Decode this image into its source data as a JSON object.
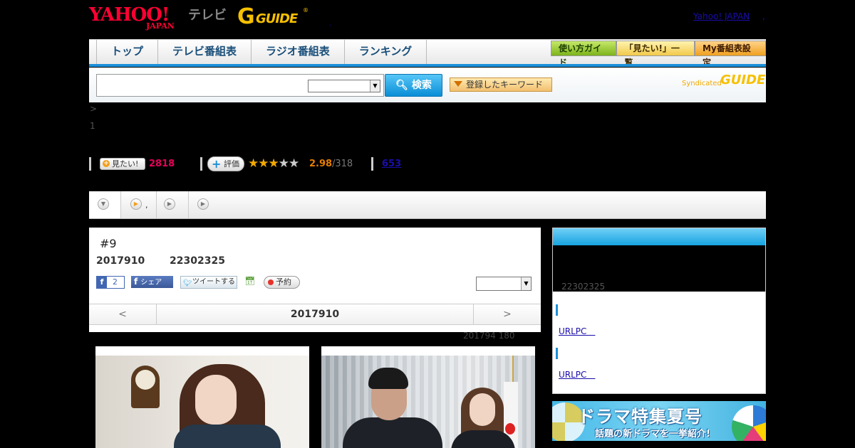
{
  "header": {
    "yahoo_logo": "YAHOO!",
    "yahoo_japan": "JAPAN",
    "tv_label": "テレビ",
    "gguide_g": "G",
    "gguide_text": "GUIDE",
    "gguide_mark": "®",
    "yahoo_japan_link": "Yahoo! JAPAN",
    "link_sep": ",",
    "dot": "."
  },
  "nav": {
    "tabs": [
      "トップ",
      "テレビ番組表",
      "ラジオ番組表",
      "ランキング"
    ],
    "buttons": [
      "使い方ガイド",
      "「見たい!」一覧",
      "My番組表設定"
    ]
  },
  "search": {
    "input_value": "",
    "select_value": "",
    "search_button": "検索",
    "keyword_button": "登録したキーワード",
    "syndicated": "Syndicated",
    "syndicated_g": "GUIDE"
  },
  "breadcrumb": ">",
  "page_number": "1",
  "stats": {
    "mitai_label": "見たい!",
    "mitai_count": "2818",
    "hyoka_label": "評価",
    "rating_value": 2.98,
    "rating_display": "2.98",
    "rating_total": "/318",
    "review_count": "653"
  },
  "subtabs": [
    "",
    ",",
    "",
    ""
  ],
  "episode": {
    "title": "#9",
    "date": "2017910",
    "time": "22302325",
    "fb_like_count": "2",
    "fb_share_label": "シェア",
    "tweet_label": "ツイートする",
    "reserve_label": "予約",
    "select_value": "",
    "pager_prev": "<",
    "pager_current": "2017910",
    "pager_next": ">",
    "meta": "201794  180"
  },
  "sidebar": {
    "time": "22302325",
    "link1": "URLPC　",
    "link2": "URLPC　"
  },
  "banner": {
    "title": "ドラマ特集夏号",
    "subtitle": "話題の新ドラマを一挙紹介!"
  },
  "icons": {
    "search": "search-icon",
    "facebook": "facebook-icon",
    "twitter": "twitter-bird-icon",
    "calendar": "calendar-add-icon",
    "record": "record-dot-icon",
    "star": "star-icon",
    "play": "play-circle-icon",
    "chevron_down": "chevron-down-icon"
  },
  "colors": {
    "accent_blue": "#1d8fd8",
    "yahoo_red": "#ff0033",
    "gguide_yellow": "#f6c000",
    "mitai_pink": "#e5005a",
    "rating_orange": "#e77e00"
  }
}
